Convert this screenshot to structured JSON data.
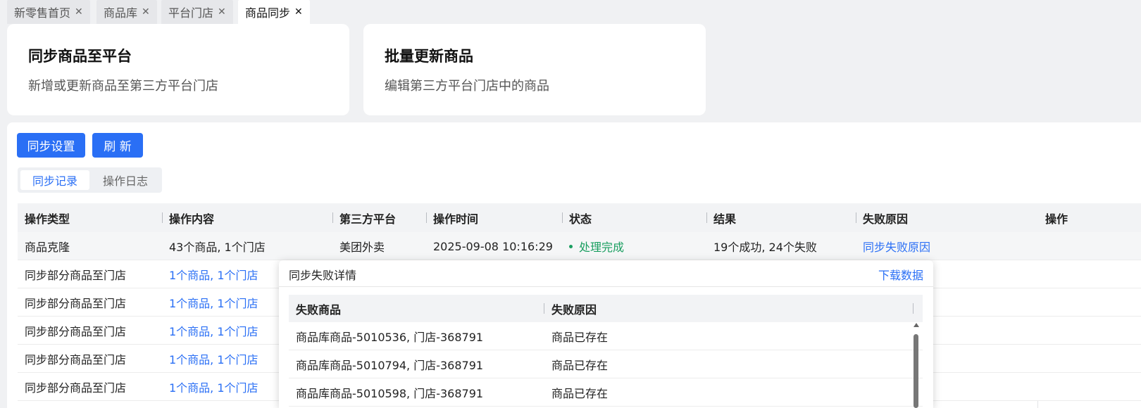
{
  "tabs": [
    {
      "label": "新零售首页",
      "close": "✕"
    },
    {
      "label": "商品库",
      "close": "✕"
    },
    {
      "label": "平台门店",
      "close": "✕"
    },
    {
      "label": "商品同步",
      "close": "✕",
      "active": true
    }
  ],
  "cards": [
    {
      "title": "同步商品至平台",
      "desc": "新增或更新商品至第三方平台门店"
    },
    {
      "title": "批量更新商品",
      "desc": "编辑第三方平台门店中的商品"
    }
  ],
  "toolbar": {
    "sync_settings": "同步设置",
    "refresh": "刷 新"
  },
  "segment": {
    "records": "同步记录",
    "logs": "操作日志"
  },
  "table": {
    "headers": [
      "操作类型",
      "操作内容",
      "第三方平台",
      "操作时间",
      "状态",
      "结果",
      "失败原因",
      "操作"
    ],
    "rows": [
      {
        "type": "商品克隆",
        "content": "43个商品, 1个门店",
        "platform": "美团外卖",
        "time": "2025-09-08 10:16:29",
        "status": "处理完成",
        "result": "19个成功, 24个失败",
        "reason": "同步失败原因"
      },
      {
        "type": "同步部分商品至门店",
        "content": "1个商品, 1个门店"
      },
      {
        "type": "同步部分商品至门店",
        "content": "1个商品, 1个门店"
      },
      {
        "type": "同步部分商品至门店",
        "content": "1个商品, 1个门店"
      },
      {
        "type": "同步部分商品至门店",
        "content": "1个商品, 1个门店"
      },
      {
        "type": "同步部分商品至门店",
        "content": "1个商品, 1个门店"
      }
    ]
  },
  "colors": {
    "accent": "#2a6ff5",
    "success": "#1a9e60"
  },
  "popup": {
    "title": "同步失败详情",
    "download": "下载数据",
    "headers": [
      "失败商品",
      "失败原因"
    ],
    "rows": [
      {
        "product": "商品库商品-5010536, 门店-368791",
        "reason": "商品已存在"
      },
      {
        "product": "商品库商品-5010794, 门店-368791",
        "reason": "商品已存在"
      },
      {
        "product": "商品库商品-5010598, 门店-368791",
        "reason": "商品已存在"
      }
    ]
  }
}
